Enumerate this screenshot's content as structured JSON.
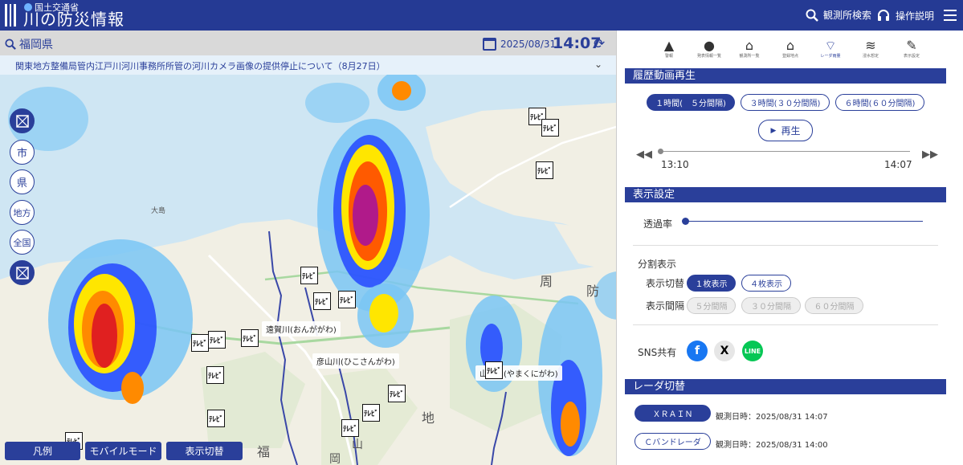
{
  "header": {
    "ministry": "国土交通省",
    "title": "川の防災情報",
    "search_label": "観測所検索",
    "help_label": "操作説明"
  },
  "map": {
    "prefecture": "福岡県",
    "date": "2025/08/31",
    "time": "14:07",
    "notice": "関東地方整備局管内江戸川河川事務所所管の河川カメラ画像の提供停止について（8月27日）",
    "scale_buttons": [
      "市",
      "県",
      "地方",
      "全国"
    ],
    "rivers": [
      {
        "label": "遠賀川(おんががわ)"
      },
      {
        "label": "彦山川(ひこさんがわ)"
      },
      {
        "label": "山国川(やまくにがわ)"
      }
    ],
    "place_labels": [
      "大島",
      "周",
      "防",
      "地",
      "福",
      "山",
      "岡"
    ],
    "bottom_buttons": [
      "凡例",
      "モバイルモード",
      "表示切替"
    ]
  },
  "panel": {
    "icon_buttons": [
      {
        "icon": "warning-icon",
        "caption": "警報"
      },
      {
        "icon": "alert-icon",
        "caption": "発表情報一覧"
      },
      {
        "icon": "house-icon",
        "caption": "観測所一覧"
      },
      {
        "icon": "home-icon",
        "caption": "登録地点"
      },
      {
        "icon": "radar-icon",
        "caption": "レーダ雨量"
      },
      {
        "icon": "wave-icon",
        "caption": "浸水想定"
      },
      {
        "icon": "wrench-icon",
        "caption": "表示設定"
      }
    ],
    "history": {
      "title": "履歴動画再生",
      "range_buttons": [
        "１時間(　５分間隔)",
        "３時間(３０分間隔)",
        "６時間(６０分間隔)"
      ],
      "play_label": "再生",
      "start_time": "13:10",
      "end_time": "14:07"
    },
    "display": {
      "title": "表示設定",
      "opacity_label": "透過率",
      "split_title": "分割表示",
      "switch_label": "表示切替",
      "switch_options": [
        "１枚表示",
        "４枚表示"
      ],
      "interval_label": "表示間隔",
      "interval_options": [
        "５分間隔",
        "３０分間隔",
        "６０分間隔"
      ],
      "sns_label": "SNS共有"
    },
    "radar": {
      "title": "レーダ切替",
      "options": [
        {
          "name": "ＸＲＡＩＮ",
          "time": "観測日時：2025/08/31 14:07"
        },
        {
          "name": "Ｃバンドレーダ",
          "time": "観測日時：2025/08/31 14:00"
        }
      ]
    }
  }
}
